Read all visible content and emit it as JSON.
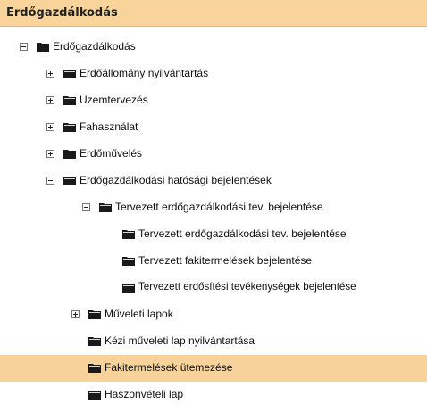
{
  "header": {
    "title": "Erdőgazdálkodás"
  },
  "icons": {
    "folder": "folder-icon",
    "expand": "plus-box-icon",
    "collapse": "minus-box-icon"
  },
  "colors": {
    "header_bg": "#f8d49a",
    "selected_bg": "#f7d39b",
    "folder": "#1a1a1a"
  },
  "tree": {
    "items": [
      {
        "label": "Erdőgazdálkodás",
        "state": "expanded"
      },
      {
        "label": "Erdőállomány nyilvántartás",
        "state": "collapsed"
      },
      {
        "label": "Üzemtervezés",
        "state": "collapsed"
      },
      {
        "label": "Fahasználat",
        "state": "collapsed"
      },
      {
        "label": "Erdőművelés",
        "state": "collapsed"
      },
      {
        "label": "Erdőgazdálkodási hatósági bejelentések",
        "state": "expanded"
      },
      {
        "label": "Tervezett erdőgazdálkodási tev. bejelentése",
        "state": "expanded"
      },
      {
        "label": "Tervezett erdőgazdálkodási tev. bejelentése",
        "state": "leaf"
      },
      {
        "label": "Tervezett fakitermelések bejelentése",
        "state": "leaf"
      },
      {
        "label": "Tervezett erdősítési tevékenységek bejelentése",
        "state": "leaf"
      },
      {
        "label": "Műveleti lapok",
        "state": "collapsed"
      },
      {
        "label": "Kézi műveleti lap nyilvántartása",
        "state": "leaf"
      },
      {
        "label": "Fakitermelések ütemezése",
        "state": "leaf",
        "selected": true
      },
      {
        "label": "Haszonvételi lap",
        "state": "leaf"
      }
    ]
  }
}
